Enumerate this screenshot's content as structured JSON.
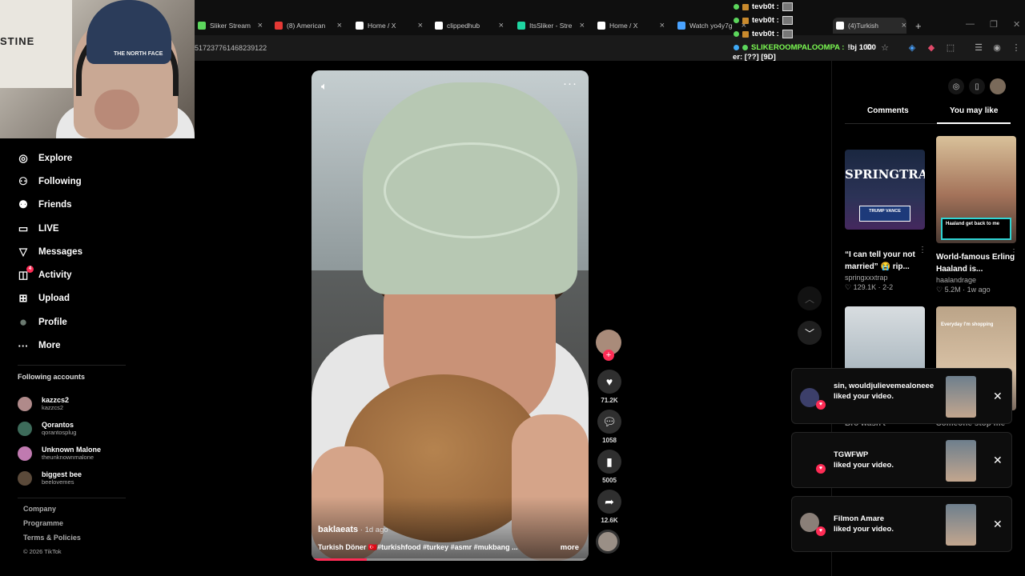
{
  "browser": {
    "tabs": [
      {
        "label": "Sliker Stream",
        "icon_color": "#5cd65c"
      },
      {
        "label": "(8) American",
        "icon_color": "#e53935"
      },
      {
        "label": "Home / X",
        "icon_color": "#ffffff"
      },
      {
        "label": "clippedhub",
        "icon_color": "#ffffff"
      },
      {
        "label": "ItsSliker - Stre",
        "icon_color": "#1fd6a2"
      },
      {
        "label": "Home / X",
        "icon_color": "#ffffff"
      },
      {
        "label": "Watch yo4y7g",
        "icon_color": "#4aa3ff"
      },
      {
        "label": "(4)Turkish",
        "icon_color": "#ffffff"
      }
    ],
    "url": "517237761468239122",
    "new_tab": "+"
  },
  "chat": {
    "lines": [
      {
        "user": "tevb0t :"
      },
      {
        "user": "tevb0t :"
      },
      {
        "user": "tevb0t :"
      }
    ],
    "highlight": {
      "user": "SLIKEROOMPALOOMPA :",
      "message": "!bj 1000"
    },
    "extra": "er: [??] [9D]"
  },
  "webcam": {
    "hat_text": "THE NORTH FACE",
    "wall_text": "STINE"
  },
  "sidebar": {
    "nav": [
      {
        "label": "Explore",
        "icon": "compass-icon",
        "glyph": "◎"
      },
      {
        "label": "Following",
        "icon": "following-icon",
        "glyph": "⚇"
      },
      {
        "label": "Friends",
        "icon": "friends-icon",
        "glyph": "⚉"
      },
      {
        "label": "LIVE",
        "icon": "live-icon",
        "glyph": "▭"
      },
      {
        "label": "Messages",
        "icon": "messages-icon",
        "glyph": "▽"
      },
      {
        "label": "Activity",
        "icon": "activity-icon",
        "glyph": "◫",
        "badge": "4"
      },
      {
        "label": "Upload",
        "icon": "upload-icon",
        "glyph": "⊞"
      },
      {
        "label": "Profile",
        "icon": "profile-avatar-icon",
        "glyph": "●"
      },
      {
        "label": "More",
        "icon": "more-icon",
        "glyph": "···"
      }
    ],
    "following_title": "Following accounts",
    "following": [
      {
        "name": "kazzcs2",
        "handle": "kazzcs2",
        "color": "#b08a8a"
      },
      {
        "name": "Qorantos",
        "handle": "qorantosplug",
        "color": "#3d6b5a"
      },
      {
        "name": "Unknown Malone",
        "handle": "theunknownmalone",
        "color": "#c07ab0"
      },
      {
        "name": "biggest bee",
        "handle": "beelovemes",
        "color": "#5b4a3a"
      }
    ],
    "footer": [
      "Company",
      "Programme",
      "Terms & Policies"
    ],
    "copyright": "© 2026 TikTok"
  },
  "video": {
    "author": "baklaeats",
    "date": " · 1d ago",
    "caption": "Turkish Döner 🇹🇷#turkishfood #turkey #asmr #mukbang ...",
    "more": "more",
    "progress": 0.2,
    "likes": "71.2K",
    "comments": "1058",
    "saves": "5005",
    "shares": "12.6K"
  },
  "right_panel": {
    "tab_comments": "Comments",
    "tab_you_may_like": "You may like",
    "cards": [
      {
        "thumb_text": "SPRINGTRAP",
        "sign_text": "TRUMP VANCE",
        "title": "“I can tell your not married” 😭 rip...",
        "user": "springxxxtrap",
        "meta": "♡ 129.1K · 2-2"
      },
      {
        "caption": "Haaland get back to me",
        "title": "World-famous Erling Haaland is...",
        "user": "haalandrage",
        "meta": "♡ 5.2M · 1w ago"
      }
    ],
    "card_overflow": [
      "Bro wasn't",
      "Someone stop me"
    ],
    "thumb4_text": "Everyday I'm shopping"
  },
  "notifications": [
    {
      "name": "sin, wouldjulievemealoneee",
      "action": "liked your video."
    },
    {
      "name": "TGWFWP",
      "action": "liked your video."
    },
    {
      "name": "Filmon Amare",
      "action": "liked your video."
    }
  ],
  "colors": {
    "accent": "#fe2c55",
    "background": "#000000"
  }
}
